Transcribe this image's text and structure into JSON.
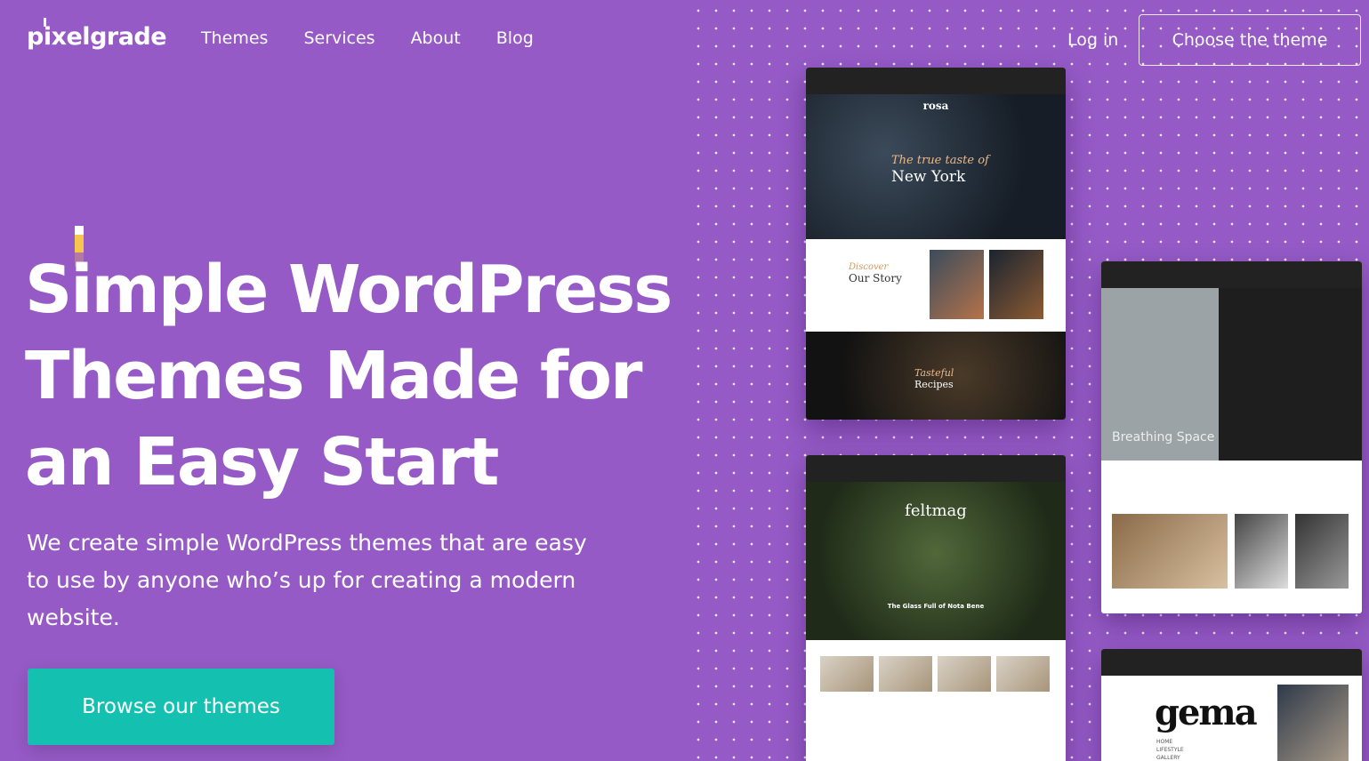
{
  "header": {
    "logo": "pixelgrade",
    "nav": [
      "Themes",
      "Services",
      "About",
      "Blog"
    ],
    "login": "Log in",
    "cta": "Choose the theme"
  },
  "hero": {
    "headline": "Simple WordPress Themes Made for an Easy Start",
    "subtitle": "We create simple WordPress themes that are easy to use by anyone who’s up for creating a modern website.",
    "button": "Browse our themes"
  },
  "previews": {
    "rosa": {
      "brand": "rosa",
      "hero_script": "The true taste of",
      "hero_title": "New York",
      "story_script": "Discover",
      "story_title": "Our Story",
      "recipes_script": "Tasteful",
      "recipes_title": "Recipes"
    },
    "noah": {
      "hero_title": "Breathing Space"
    },
    "felt": {
      "brand": "feltmag",
      "caption": "The Glass Full of Nota Bene"
    },
    "gema": {
      "brand": "gema",
      "menu": [
        "HOME",
        "LIFESTYLE",
        "GALLERY"
      ]
    }
  },
  "colors": {
    "background": "#955ac6",
    "accent": "#14c1b1"
  }
}
